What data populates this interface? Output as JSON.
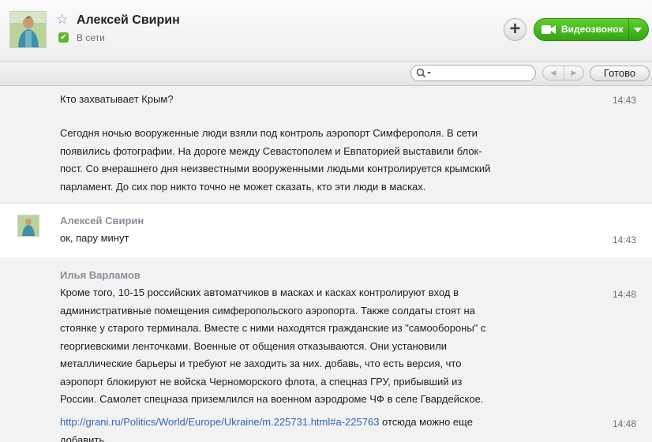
{
  "header": {
    "contact_name": "Алексей Свирин",
    "status": "В сети",
    "video_call_label": "Видеозвонок"
  },
  "toolbar": {
    "search_placeholder": "",
    "done_label": "Готово"
  },
  "messages": [
    {
      "lines": [
        "Кто захватывает Крым?"
      ],
      "time": "14:43"
    },
    {
      "lines": [
        "Сегодня ночью вооруженные люди взяли под контроль аэропорт Симферополя. В сети",
        "появились фотографии. На дороге между Севастополем и Евпаторией выставили блок-",
        "пост. Со вчерашнего дня неизвестными вооруженными людьми контролируется крымский",
        "парламент. До сих пор никто точно не может сказать, кто эти люди в масках."
      ]
    },
    {
      "sender": "Алексей Свирин",
      "lines": [
        "ок, пару минут"
      ],
      "time": "14:43"
    },
    {
      "sender": "Илья Варламов",
      "lines": [
        "Кроме того, 10-15 российских автоматчиков в масках и касках контролируют вход в",
        "административные помещения симферопольского аэропорта. Также солдаты стоят на",
        "стоянке у старого терминала. Вместе с ними находятся гражданские из \"самообороны\" с",
        "георгиевскими ленточками. Военные от общения отказываются. Они установили",
        "металлические барьеры и требуют не заходить за них.  добавь, что есть версия, что",
        "аэропорт блокируют не войска Черноморского флота, а спецназ ГРУ, прибывший из",
        "России. Самолет спецназа приземлился на военном аэродроме ЧФ в селе Гвардейское."
      ],
      "time": "14:48"
    },
    {
      "link": "http://grani.ru/Politics/World/Europe/Ukraine/m.225731.html#a-225763",
      "link_suffix": " отсюда можно еще",
      "line2": "добавить",
      "time": "14:48"
    }
  ],
  "colors": {
    "accent_green": "#43b620",
    "link_blue": "#2c66b5",
    "sender_gray": "#8a8f99"
  },
  "icons": [
    "star-icon",
    "online-status-icon",
    "plus-icon",
    "video-camera-icon",
    "chevron-down-icon",
    "search-icon",
    "arrow-left-icon",
    "arrow-right-icon"
  ]
}
